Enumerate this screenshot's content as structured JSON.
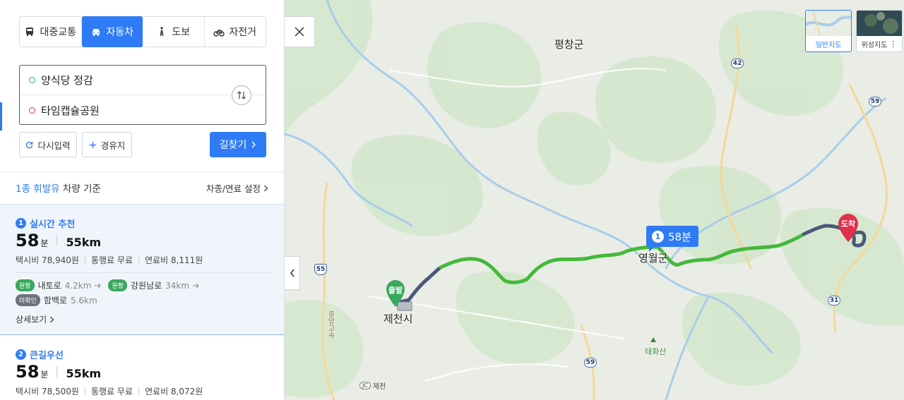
{
  "modes": [
    {
      "label": "대중교통",
      "icon": "bus-icon",
      "active": false
    },
    {
      "label": "자동차",
      "icon": "car-icon",
      "active": true
    },
    {
      "label": "도보",
      "icon": "walk-icon",
      "active": false
    },
    {
      "label": "자전거",
      "icon": "bicycle-icon",
      "active": false
    }
  ],
  "route": {
    "origin": "양식당 정감",
    "destination": "타임캡슐공원"
  },
  "buttons": {
    "reset": "다시입력",
    "waypoint": "경유지",
    "search": "길찾기"
  },
  "criteria": {
    "fuel_type": "1종 휘발유",
    "suffix": "차량 기준",
    "settings_link": "차종/연료 설정"
  },
  "results": [
    {
      "index": "1",
      "title": "실시간 추천",
      "time": "58",
      "time_unit": "분",
      "distance": "55km",
      "taxi": "택시비 78,940원",
      "toll": "통행료 무료",
      "fuel": "연료비 8,111원",
      "roads": [
        {
          "tag": "원활",
          "name": "내토로",
          "km": "4.2km"
        },
        {
          "tag": "원활",
          "name": "강원남로",
          "km": "34km"
        },
        {
          "tag": "미확인",
          "name": "함백로",
          "km": "5.6km"
        }
      ],
      "detail": "상세보기"
    },
    {
      "index": "2",
      "title": "큰길우선",
      "time": "58",
      "time_unit": "분",
      "distance": "55km",
      "taxi": "택시비 78,500원",
      "toll": "통행료 무료",
      "fuel": "연료비 8,072원"
    }
  ],
  "map": {
    "labels": {
      "pyeongchang": "평창군",
      "yeongwol": "영월군",
      "jecheon": "제천시",
      "taehwasan": "태화산",
      "jecheon_jc": "제천",
      "jc_mark": "JC",
      "expressway": "중앙고속"
    },
    "route_bubble": {
      "index": "1",
      "time": "58분"
    },
    "start_pin": "출발",
    "end_pin": "도착",
    "road_shields": [
      "42",
      "59",
      "55",
      "31",
      "59"
    ],
    "map_types": {
      "normal": "일반지도",
      "satellite": "위성지도"
    },
    "colors": {
      "route_smooth": "#43b93a",
      "route_unknown": "#4b5a7a",
      "accent": "#2f7bf5",
      "dest_pin": "#e0304c",
      "start_pin": "#3aa85c"
    }
  }
}
